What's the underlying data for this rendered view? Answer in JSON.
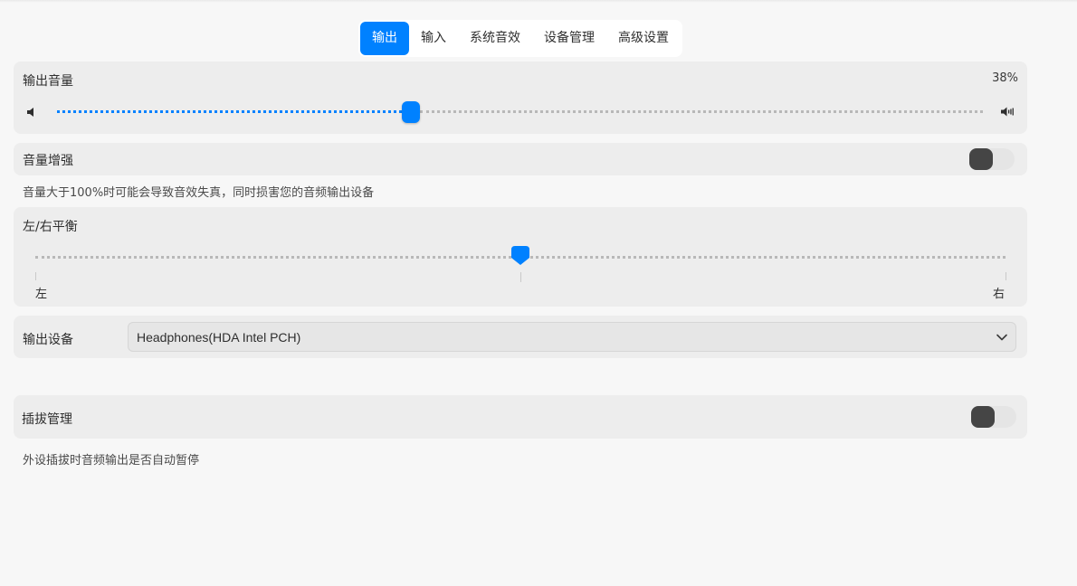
{
  "tabs": [
    {
      "label": "输出",
      "active": true
    },
    {
      "label": "输入",
      "active": false
    },
    {
      "label": "系统音效",
      "active": false
    },
    {
      "label": "设备管理",
      "active": false
    },
    {
      "label": "高级设置",
      "active": false
    }
  ],
  "output_volume": {
    "label": "输出音量",
    "value_text": "38%",
    "level": 0.38,
    "min_icon": "volume-low-icon",
    "max_icon": "volume-high-icon"
  },
  "volume_boost": {
    "label": "音量增强",
    "enabled": false,
    "hint": "音量大于100%时可能会导致音效失真，同时损害您的音频输出设备"
  },
  "balance": {
    "label": "左/右平衡",
    "left_label": "左",
    "right_label": "右",
    "level": 0.5
  },
  "output_device": {
    "label": "输出设备",
    "selected": "Headphones(HDA Intel PCH)",
    "dropdown_icon": "chevron-down-icon"
  },
  "plug_management": {
    "label": "插拔管理",
    "enabled": false,
    "hint": "外设插拔时音频输出是否自动暂停"
  },
  "colors": {
    "accent": "#0081ff",
    "card_bg": "#ededed",
    "toggle_knob": "#454545"
  }
}
